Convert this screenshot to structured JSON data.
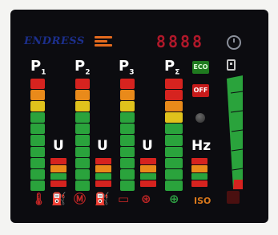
{
  "header": {
    "brand": "ENDRESS",
    "counter": "8888"
  },
  "meters": {
    "p1": {
      "label": "P",
      "sub": "1"
    },
    "p2": {
      "label": "P",
      "sub": "2"
    },
    "p3": {
      "label": "P",
      "sub": "3"
    },
    "p4": {
      "label": "P",
      "sub": "Σ"
    }
  },
  "indicators": {
    "eco": "ECO",
    "off": "OFF"
  },
  "units": {
    "u1": "U",
    "u2": "U",
    "u3": "U",
    "hz": "Hz"
  },
  "bottom_icons": [
    "temperature-icon",
    "oil-can-icon",
    "engine-icon",
    "fuel-pump-icon",
    "battery-icon",
    "alternator-icon",
    "earth-icon",
    "iso-icon"
  ],
  "bottom_text": {
    "iso": "ISO"
  },
  "colors": {
    "red": "#d6231f",
    "orange": "#e98a1a",
    "yellow": "#e0c21c",
    "green": "#2aa33c",
    "brand_blue": "#1c2f8c"
  }
}
